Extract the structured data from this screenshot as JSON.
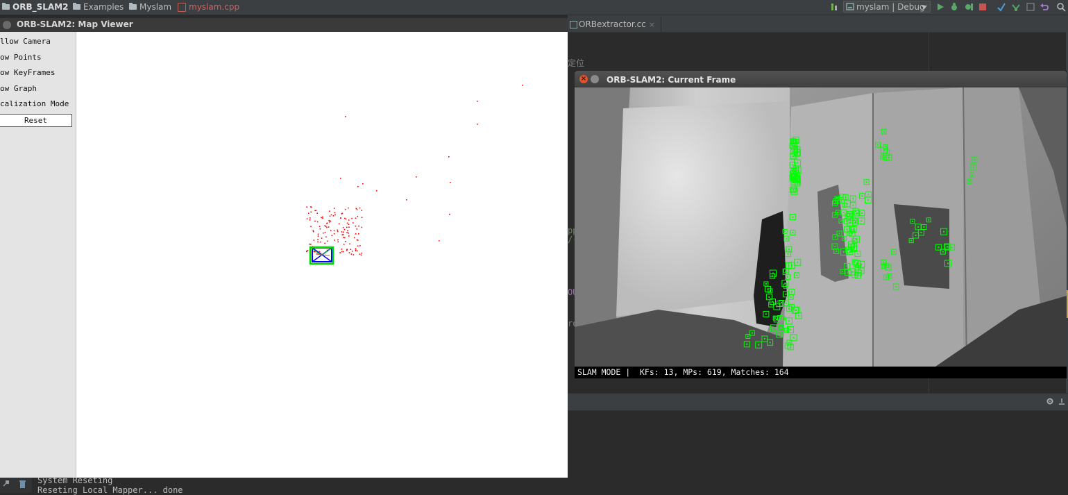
{
  "ide": {
    "breadcrumbs": [
      "ORB_SLAM2",
      "Examples",
      "Myslam",
      "myslam.cpp"
    ],
    "run_config": "myslam | Debug",
    "editor_tab": "ORBextractor.cc",
    "editor_fragments": [
      "定位",
      "pp",
      "/(",
      "OU",
      "ro"
    ]
  },
  "map_viewer": {
    "title": "ORB-SLAM2: Map Viewer",
    "menu": [
      "llow Camera",
      "ow Points",
      "ow KeyFrames",
      "ow Graph",
      "calization Mode"
    ],
    "reset_label": "Reset",
    "point_color": "#ff0000",
    "keyframe_color": "#0000ff",
    "current_camera_color": "#00ff00"
  },
  "current_frame": {
    "title": "ORB-SLAM2: Current Frame",
    "status": "SLAM MODE |  KFs: 13, MPs: 619, Matches: 164",
    "feature_color": "#00ff00"
  },
  "console": {
    "lines": [
      "System Reseting",
      "Reseting Local Mapper... done"
    ]
  }
}
